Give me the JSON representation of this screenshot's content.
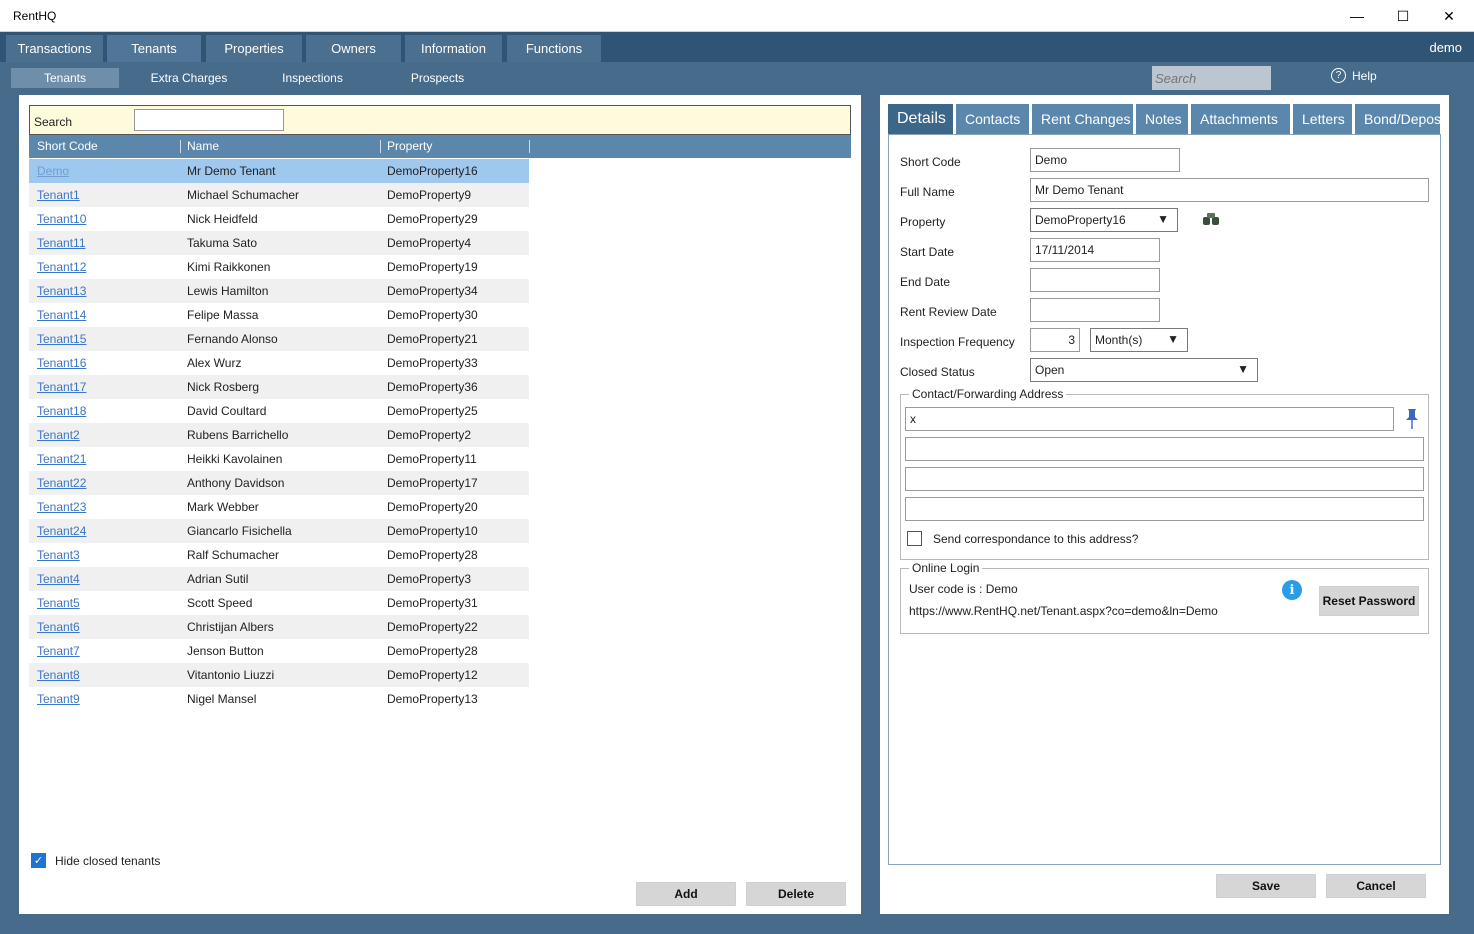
{
  "window": {
    "title": "RentHQ",
    "minimize": "—",
    "maximize": "☐",
    "close": "✕"
  },
  "topnav": {
    "tabs": [
      "Transactions",
      "Tenants",
      "Properties",
      "Owners",
      "Information",
      "Functions"
    ],
    "active": "Tenants",
    "user": "demo"
  },
  "subnav": {
    "items": [
      "Tenants",
      "Extra Charges",
      "Inspections",
      "Prospects"
    ],
    "active": "Tenants",
    "search_placeholder": "Search",
    "help_label": "Help",
    "help_icon": "?"
  },
  "list": {
    "search_label": "Search",
    "search_value": "",
    "columns": [
      "Short Code",
      "Name",
      "Property"
    ],
    "rows": [
      [
        "Demo",
        "Mr Demo Tenant",
        "DemoProperty16"
      ],
      [
        "Tenant1",
        "Michael Schumacher",
        "DemoProperty9"
      ],
      [
        "Tenant10",
        "Nick Heidfeld",
        "DemoProperty29"
      ],
      [
        "Tenant11",
        "Takuma Sato",
        "DemoProperty4"
      ],
      [
        "Tenant12",
        "Kimi Raikkonen",
        "DemoProperty19"
      ],
      [
        "Tenant13",
        "Lewis Hamilton",
        "DemoProperty34"
      ],
      [
        "Tenant14",
        "Felipe Massa",
        "DemoProperty30"
      ],
      [
        "Tenant15",
        "Fernando Alonso",
        "DemoProperty21"
      ],
      [
        "Tenant16",
        "Alex Wurz",
        "DemoProperty33"
      ],
      [
        "Tenant17",
        "Nick Rosberg",
        "DemoProperty36"
      ],
      [
        "Tenant18",
        "David Coultard",
        "DemoProperty25"
      ],
      [
        "Tenant2",
        "Rubens Barrichello",
        "DemoProperty2"
      ],
      [
        "Tenant21",
        "Heikki Kavolainen",
        "DemoProperty11"
      ],
      [
        "Tenant22",
        "Anthony Davidson",
        "DemoProperty17"
      ],
      [
        "Tenant23",
        "Mark Webber",
        "DemoProperty20"
      ],
      [
        "Tenant24",
        "Giancarlo Fisichella",
        "DemoProperty10"
      ],
      [
        "Tenant3",
        "Ralf Schumacher",
        "DemoProperty28"
      ],
      [
        "Tenant4",
        "Adrian Sutil",
        "DemoProperty3"
      ],
      [
        "Tenant5",
        "Scott Speed",
        "DemoProperty31"
      ],
      [
        "Tenant6",
        "Christijan Albers",
        "DemoProperty22"
      ],
      [
        "Tenant7",
        "Jenson Button",
        "DemoProperty28"
      ],
      [
        "Tenant8",
        "Vitantonio Liuzzi",
        "DemoProperty12"
      ],
      [
        "Tenant9",
        "Nigel Mansel",
        "DemoProperty13"
      ]
    ],
    "selected_index": 0,
    "hide_closed_label": "Hide closed tenants",
    "hide_closed_checked": true,
    "add_label": "Add",
    "delete_label": "Delete"
  },
  "details": {
    "tabs": [
      "Details",
      "Contacts",
      "Rent Changes",
      "Notes",
      "Attachments",
      "Letters",
      "Bond/Deposit"
    ],
    "active_tab": "Details",
    "labels": {
      "short_code": "Short Code",
      "full_name": "Full Name",
      "property": "Property",
      "start_date": "Start Date",
      "end_date": "End Date",
      "rent_review_date": "Rent Review Date",
      "inspection_frequency": "Inspection Frequency",
      "closed_status": "Closed Status"
    },
    "values": {
      "short_code": "Demo",
      "full_name": "Mr Demo Tenant",
      "property": "DemoProperty16",
      "start_date": "17/11/2014",
      "end_date": "",
      "rent_review_date": "",
      "inspection_frequency": "3",
      "inspection_unit": "Month(s)",
      "closed_status": "Open"
    },
    "address": {
      "legend": "Contact/Forwarding Address",
      "lines": [
        "x",
        "",
        "",
        ""
      ],
      "send_label": "Send correspondance to this address?",
      "send_checked": false
    },
    "online_login": {
      "legend": "Online Login",
      "user_code": "User code is : Demo",
      "url": "https://www.RentHQ.net/Tenant.aspx?co=demo&ln=Demo",
      "reset_label": "Reset Password",
      "info_icon": "i"
    },
    "save_label": "Save",
    "cancel_label": "Cancel"
  },
  "colors": {
    "nav_dark": "#2f5474",
    "nav": "#466b8b",
    "header": "#5b87ad",
    "selected_row": "#9ec8ee",
    "search_bg": "#fefbdc",
    "info": "#2a9de9"
  }
}
